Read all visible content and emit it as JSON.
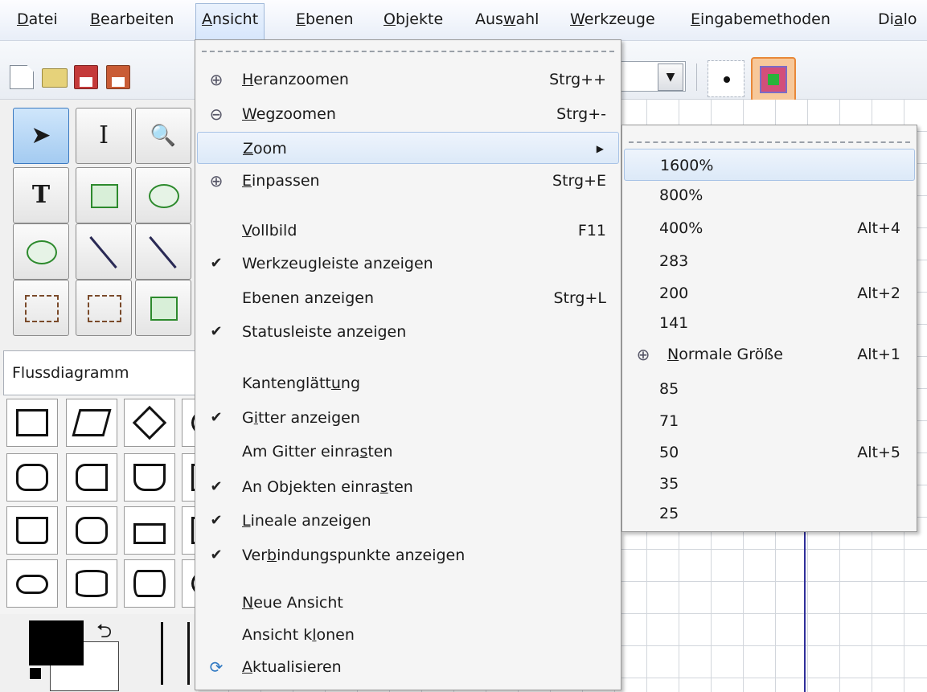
{
  "menubar": {
    "items": [
      {
        "label": "Datei",
        "mn": "D",
        "rest": "atei"
      },
      {
        "label": "Bearbeiten",
        "mn": "B",
        "rest": "earbeiten"
      },
      {
        "label": "Ansicht",
        "mn": "A",
        "rest": "nsicht"
      },
      {
        "label": "Ebenen",
        "mn": "E",
        "rest": "benen"
      },
      {
        "label": "Objekte",
        "mn": "O",
        "rest": "bjekte"
      },
      {
        "label": "Auswahl",
        "pre": "Aus",
        "mn": "w",
        "rest": "ahl"
      },
      {
        "label": "Werkzeuge",
        "mn": "W",
        "rest": "erkzeuge"
      },
      {
        "label": "Eingabemethoden",
        "mn": "E",
        "rest": "ingabemethoden"
      },
      {
        "label": "Dialo",
        "pre": "Di",
        "mn": "a",
        "rest": "lo"
      }
    ]
  },
  "sheet_selector": {
    "value": "Flussdiagramm"
  },
  "view_menu": {
    "items": [
      {
        "pre": "",
        "mn": "H",
        "rest": "eranzoomen",
        "shortcut": "Strg++",
        "icon": "zoom-in-icon"
      },
      {
        "pre": "",
        "mn": "W",
        "rest": "egzoomen",
        "shortcut": "Strg+-",
        "icon": "zoom-out-icon"
      },
      {
        "pre": "",
        "mn": "Z",
        "rest": "oom",
        "shortcut": "",
        "icon": "",
        "submenu": true
      },
      {
        "pre": "",
        "mn": "E",
        "rest": "inpassen",
        "shortcut": "Strg+E",
        "icon": "zoom-fit-icon"
      },
      {
        "pre": "",
        "mn": "V",
        "rest": "ollbild",
        "shortcut": "F11"
      },
      {
        "pre": "Werkzeugleiste anzeigen",
        "mn": "",
        "rest": "",
        "shortcut": "",
        "checked": true
      },
      {
        "pre": "Ebenen anzeigen",
        "mn": "",
        "rest": "",
        "shortcut": "Strg+L"
      },
      {
        "pre": "Statusleiste anzeigen",
        "mn": "",
        "rest": "",
        "shortcut": "",
        "checked": true
      },
      {
        "pre": "Kantenglätt",
        "mn": "u",
        "rest": "ng",
        "shortcut": ""
      },
      {
        "pre": "G",
        "mn": "i",
        "rest": "tter anzeigen",
        "shortcut": "",
        "checked": true
      },
      {
        "pre": "Am Gitter einra",
        "mn": "s",
        "rest": "ten",
        "shortcut": ""
      },
      {
        "pre": "An Objekten einra",
        "mn": "s",
        "rest": "ten",
        "shortcut": "",
        "checked": true
      },
      {
        "pre": "",
        "mn": "L",
        "rest": "ineale anzeigen",
        "shortcut": "",
        "checked": true
      },
      {
        "pre": "Ver",
        "mn": "b",
        "rest": "indungspunkte anzeigen",
        "shortcut": "",
        "checked": true
      },
      {
        "pre": "",
        "mn": "N",
        "rest": "eue Ansicht",
        "shortcut": ""
      },
      {
        "pre": "Ansicht k",
        "mn": "l",
        "rest": "onen",
        "shortcut": ""
      },
      {
        "pre": "",
        "mn": "A",
        "rest": "ktualisieren",
        "shortcut": "",
        "icon": "refresh-icon"
      }
    ]
  },
  "zoom_menu": {
    "items": [
      {
        "pre": "1600%",
        "mn": "",
        "rest": "",
        "shortcut": ""
      },
      {
        "pre": "800%",
        "mn": "",
        "rest": "",
        "shortcut": ""
      },
      {
        "pre": "400%",
        "mn": "",
        "rest": "",
        "shortcut": "Alt+4"
      },
      {
        "pre": "283",
        "mn": "",
        "rest": "",
        "shortcut": ""
      },
      {
        "pre": "200",
        "mn": "",
        "rest": "",
        "shortcut": "Alt+2"
      },
      {
        "pre": "141",
        "mn": "",
        "rest": "",
        "shortcut": ""
      },
      {
        "pre": "",
        "mn": "N",
        "rest": "ormale Größe",
        "shortcut": "Alt+1",
        "icon": "zoom-normal-icon"
      },
      {
        "pre": "85",
        "mn": "",
        "rest": "",
        "shortcut": ""
      },
      {
        "pre": "71",
        "mn": "",
        "rest": "",
        "shortcut": ""
      },
      {
        "pre": "50",
        "mn": "",
        "rest": "",
        "shortcut": "Alt+5"
      },
      {
        "pre": "35",
        "mn": "",
        "rest": "",
        "shortcut": ""
      },
      {
        "pre": "25",
        "mn": "",
        "rest": "",
        "shortcut": ""
      }
    ]
  },
  "icons": {
    "zoom_in": "⊕",
    "zoom_out": "⊖",
    "zoom_fit": "⊕",
    "zoom_normal": "⊕",
    "refresh": "⟳",
    "check": "✔",
    "submenu_arrow": "▶",
    "dropdown_arrow": "▼",
    "swap": "⮌",
    "pointer": "➤",
    "text_cursor": "I",
    "magnifier": "🔍",
    "text_tool": "T"
  },
  "colors": {
    "accent": "#3b79c0",
    "highlight": "#dce9f8",
    "grid_line": "#d2d6dc"
  }
}
